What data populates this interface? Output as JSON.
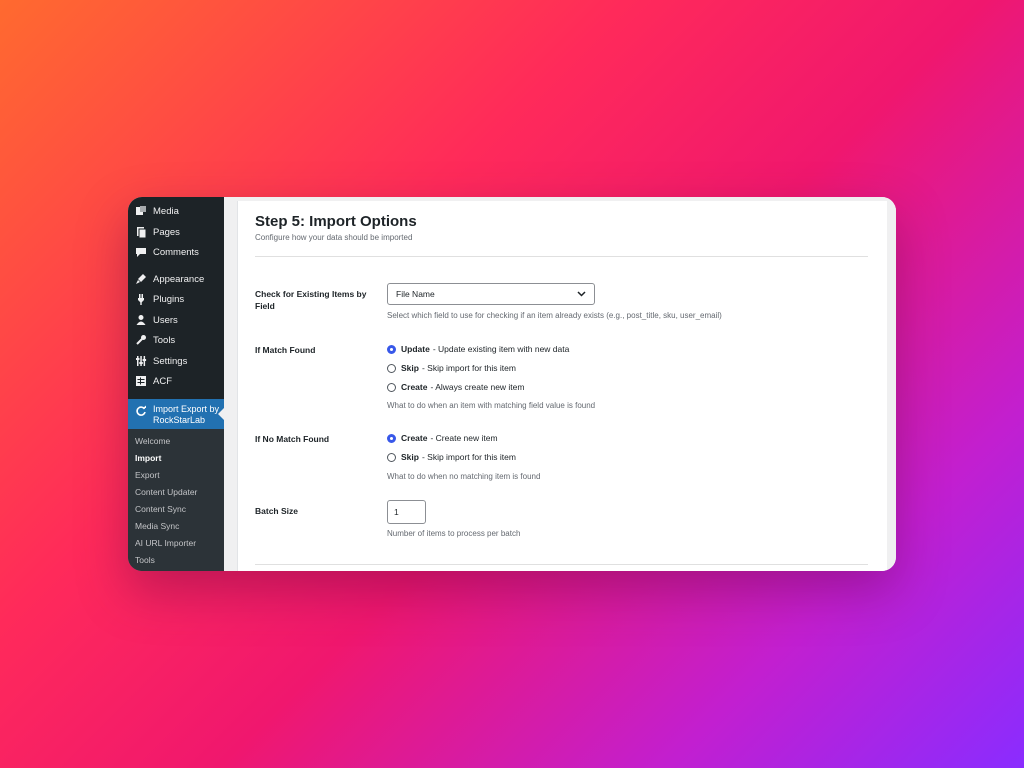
{
  "sidebar": {
    "items": [
      {
        "label": "Media",
        "icon": "media-icon"
      },
      {
        "label": "Pages",
        "icon": "pages-icon"
      },
      {
        "label": "Comments",
        "icon": "comments-icon"
      },
      {
        "label": "Appearance",
        "icon": "appearance-icon"
      },
      {
        "label": "Plugins",
        "icon": "plugins-icon"
      },
      {
        "label": "Users",
        "icon": "users-icon"
      },
      {
        "label": "Tools",
        "icon": "tools-icon"
      },
      {
        "label": "Settings",
        "icon": "settings-icon"
      },
      {
        "label": "ACF",
        "icon": "acf-icon"
      }
    ],
    "active": {
      "label": "Import Export by RockStarLab",
      "icon": "sync-icon"
    },
    "submenu": [
      "Welcome",
      "Import",
      "Export",
      "Content Updater",
      "Content Sync",
      "Media Sync",
      "AI URL Importer",
      "Tools"
    ],
    "current_submenu": "Import"
  },
  "main": {
    "title": "Step 5: Import Options",
    "subtitle": "Configure how your data should be imported",
    "check_existing": {
      "label": "Check for Existing Items by Field",
      "value": "File Name",
      "help": "Select which field to use for checking if an item already exists (e.g., post_title, sku, user_email)"
    },
    "if_match": {
      "label": "If Match Found",
      "options": [
        {
          "name": "Update",
          "desc": " - Update existing item with new data",
          "checked": true
        },
        {
          "name": "Skip",
          "desc": " - Skip import for this item",
          "checked": false
        },
        {
          "name": "Create",
          "desc": " - Always create new item",
          "checked": false
        }
      ],
      "help": "What to do when an item with matching field value is found"
    },
    "if_no_match": {
      "label": "If No Match Found",
      "options": [
        {
          "name": "Create",
          "desc": " - Create new item",
          "checked": true
        },
        {
          "name": "Skip",
          "desc": " - Skip import for this item",
          "checked": false
        }
      ],
      "help": "What to do when no matching item is found"
    },
    "batch": {
      "label": "Batch Size",
      "value": "1",
      "help": "Number of items to process per batch"
    }
  },
  "colors": {
    "accent": "#3858e9",
    "admin_bar": "#1d2327",
    "active_menu": "#2271b1"
  }
}
